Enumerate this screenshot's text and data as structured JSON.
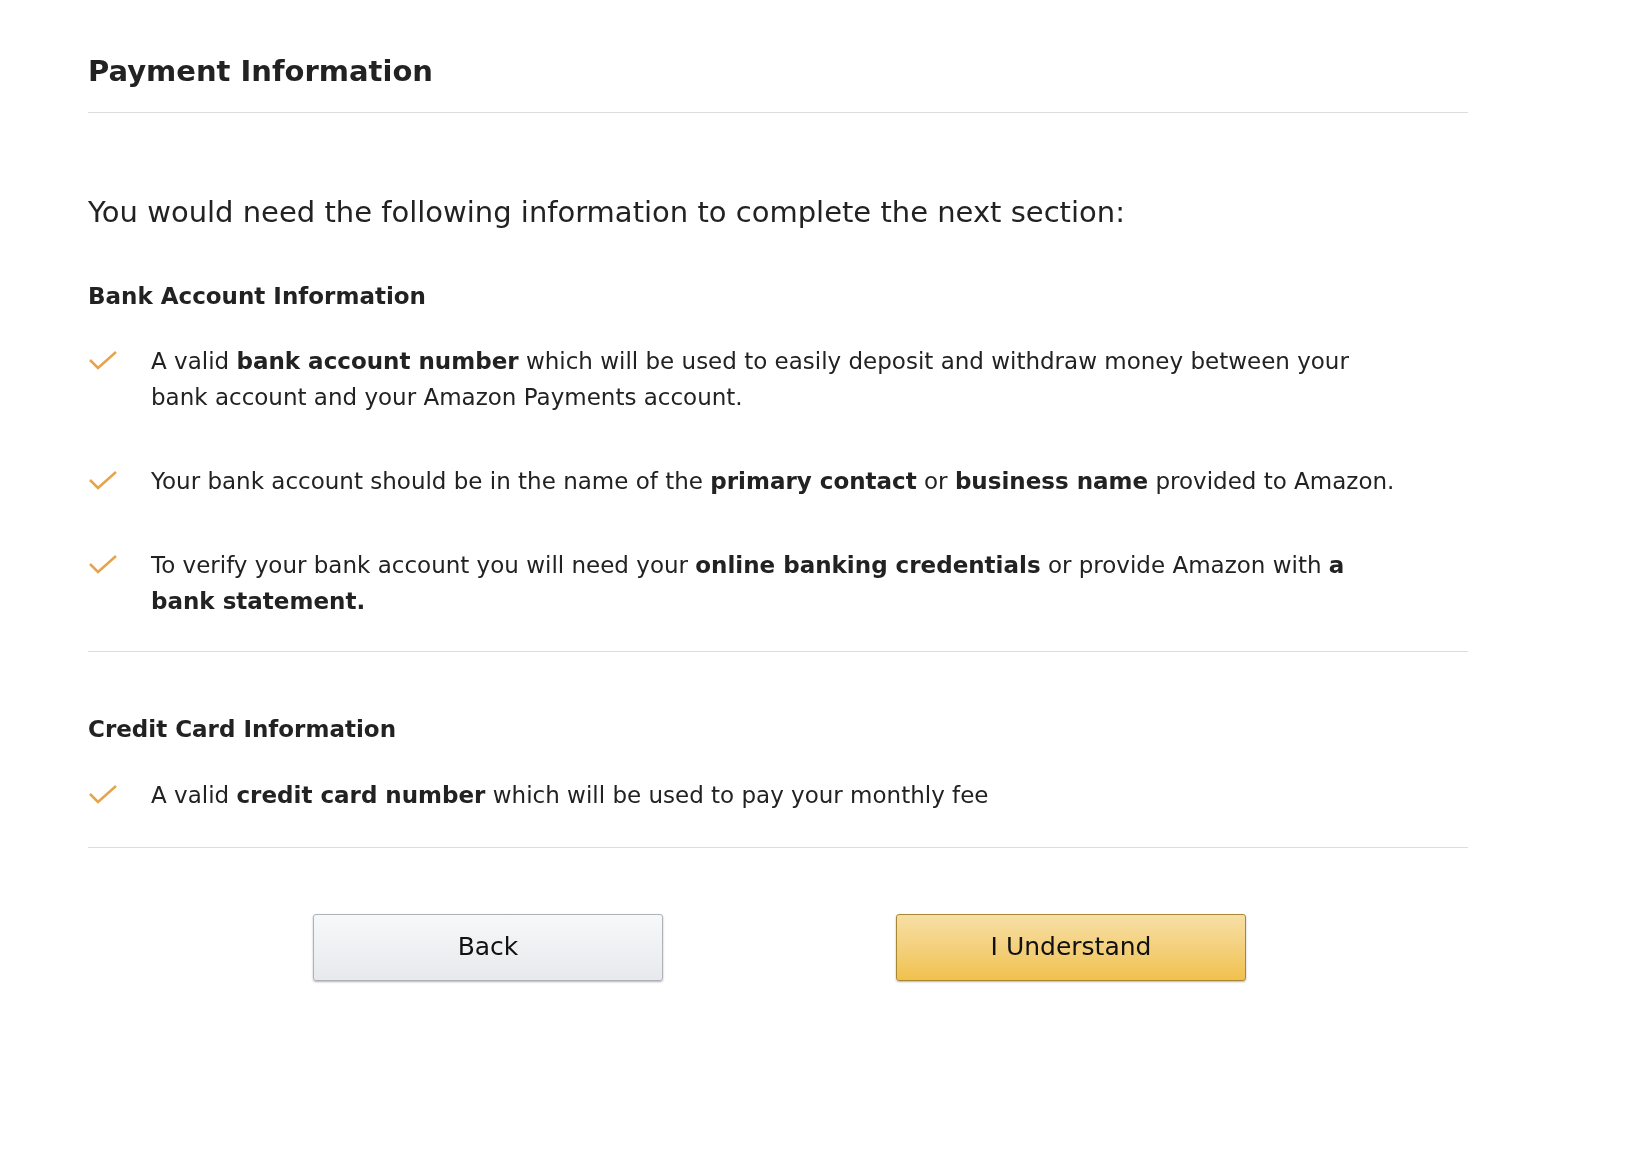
{
  "title": "Payment Information",
  "intro": "You would need the following information to complete the next section:",
  "sections": [
    {
      "heading": "Bank Account Information",
      "items": [
        "A valid **bank account number** which will be used to easily deposit and withdraw money between your bank account and your Amazon Payments account.",
        "Your bank account should be in the name of the **primary contact** or **business name** provided to Amazon.",
        "To verify your bank account you will need your **online banking credentials** or provide Amazon with **a bank statement.**"
      ]
    },
    {
      "heading": "Credit Card Information",
      "items": [
        "A valid **credit card number** which will be used to pay your monthly fee"
      ]
    }
  ],
  "buttons": [
    {
      "label": "Back",
      "kind": "secondary"
    },
    {
      "label": "I Understand",
      "kind": "primary"
    }
  ]
}
